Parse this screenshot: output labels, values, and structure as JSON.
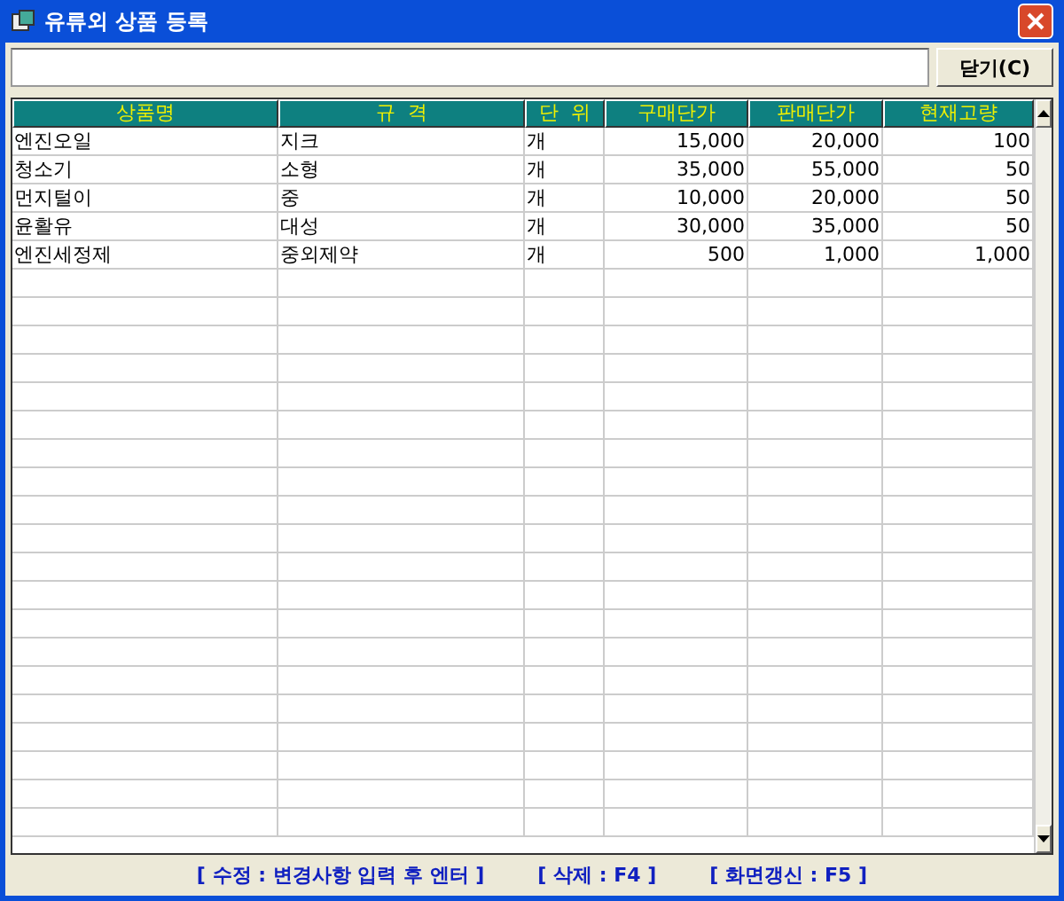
{
  "window": {
    "title": "유류외 상품 등록"
  },
  "toolbar": {
    "close_button": "닫기(C)"
  },
  "table": {
    "columns": [
      "상품명",
      "규  격",
      "단  위",
      "구매단가",
      "판매단가",
      "현재고량"
    ],
    "rows": [
      [
        "엔진오일",
        "지크",
        "개",
        "15,000",
        "20,000",
        "100"
      ],
      [
        "청소기",
        "소형",
        "개",
        "35,000",
        "55,000",
        "50"
      ],
      [
        "먼지털이",
        "중",
        "개",
        "10,000",
        "20,000",
        "50"
      ],
      [
        "윤활유",
        "대성",
        "개",
        "30,000",
        "35,000",
        "50"
      ],
      [
        "엔진세정제",
        "중외제약",
        "개",
        "500",
        "1,000",
        "1,000"
      ]
    ]
  },
  "status_bar": [
    "[ 수정 : 변경사항 입력 후 엔터 ]",
    "[ 삭제 : F4 ]",
    "[ 화면갱신 : F5 ]"
  ]
}
